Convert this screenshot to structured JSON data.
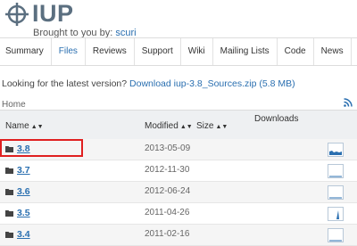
{
  "header": {
    "title": "IUP",
    "byline_prefix": "Brought to you by:",
    "byline_author": "scuri"
  },
  "nav": {
    "items": [
      {
        "label": "Summary",
        "active": false
      },
      {
        "label": "Files",
        "active": true
      },
      {
        "label": "Reviews",
        "active": false
      },
      {
        "label": "Support",
        "active": false
      },
      {
        "label": "Wiki",
        "active": false
      },
      {
        "label": "Mailing Lists",
        "active": false
      },
      {
        "label": "Code",
        "active": false
      },
      {
        "label": "News",
        "active": false
      }
    ]
  },
  "latest": {
    "prompt": "Looking for the latest version?",
    "link": "Download iup-3.8_Sources.zip (5.8 MB)"
  },
  "breadcrumb": "Home",
  "table": {
    "columns": {
      "name": "Name",
      "modified": "Modified",
      "size": "Size",
      "downloads": "Downloads"
    },
    "rows": [
      {
        "name": "3.8",
        "modified": "2013-05-09"
      },
      {
        "name": "3.7",
        "modified": "2012-11-30"
      },
      {
        "name": "3.6",
        "modified": "2012-06-24"
      },
      {
        "name": "3.5",
        "modified": "2011-04-26"
      },
      {
        "name": "3.4",
        "modified": "2011-02-16"
      }
    ]
  },
  "colors": {
    "accent": "#2a6fb0",
    "highlight": "#e02020"
  }
}
